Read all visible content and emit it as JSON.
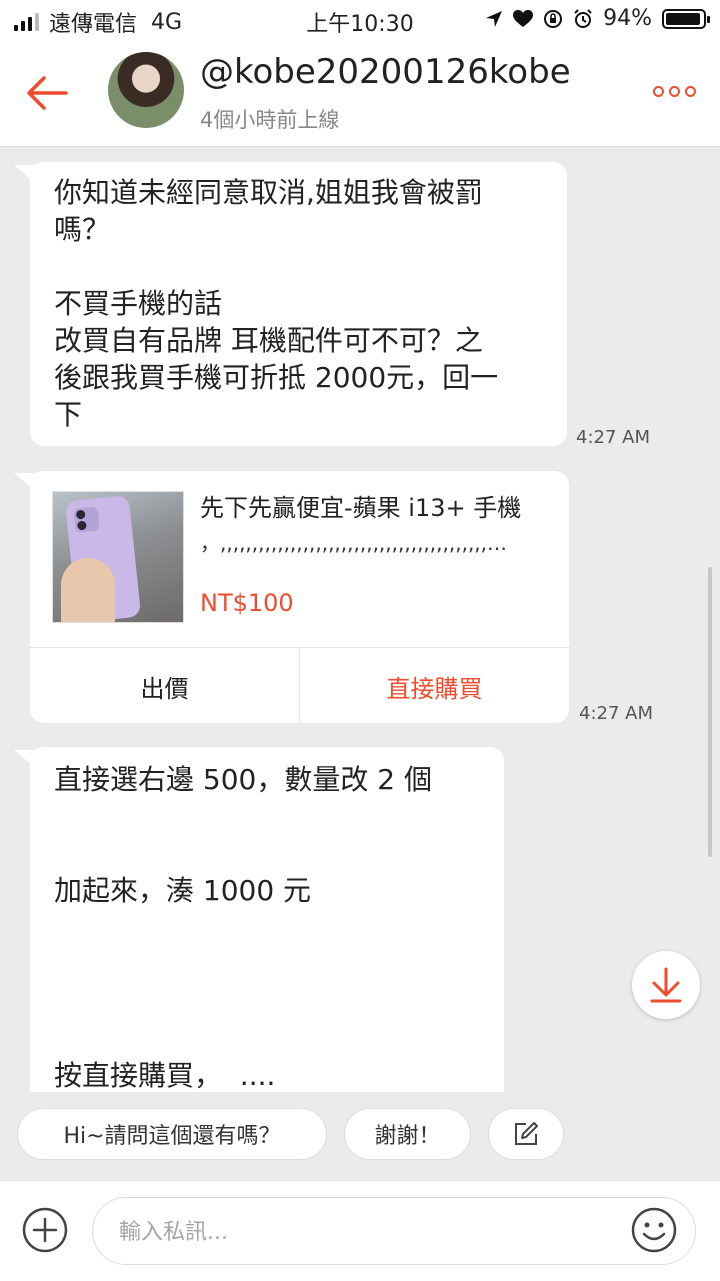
{
  "status_bar": {
    "carrier": "遠傳電信",
    "network": "4G",
    "time": "上午10:30",
    "battery": "94%",
    "battery_level": 0.94
  },
  "header": {
    "username": "@kobe20200126kobe",
    "last_seen": "4個小時前上線"
  },
  "messages": [
    {
      "text": "你知道未經同意取消,姐姐我會被罰\n嗎？\n\n不買手機的話\n改買自有品牌 耳機配件可不可？之\n後跟我買手機可折抵 2000元，回一\n下",
      "time": "4:27 AM"
    },
    {
      "product": {
        "title": "先下先贏便宜-蘋果 i13+ 手機",
        "subtitle": "，,,,,,,,,,,,,,,,,,,,,,,,,,,,,,,,,,,,,,,,,,,…",
        "price": "NT$100",
        "offer_label": "出價",
        "buy_label": "直接購買"
      },
      "time": "4:27 AM"
    },
    {
      "text": "直接選右邊 500，數量改 2 個\n\n\n加起來，湊 1000 元\n\n\n\n\n按直接購買，  ...."
    }
  ],
  "quick_replies": [
    "Hi~請問這個還有嗎？",
    "謝謝！"
  ],
  "input": {
    "placeholder": "輸入私訊..."
  },
  "colors": {
    "accent": "#ee4d2d",
    "chat_bg": "#ebebeb",
    "bubble": "#ffffff"
  },
  "icons": [
    "back-arrow-icon",
    "more-icon",
    "scroll-down-icon",
    "edit-icon",
    "plus-icon",
    "emoji-icon"
  ]
}
